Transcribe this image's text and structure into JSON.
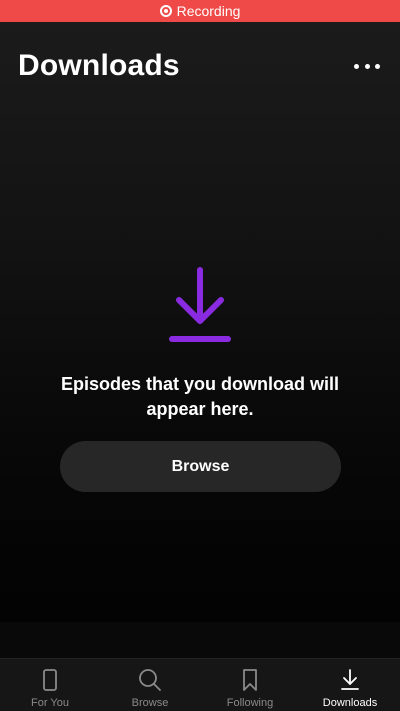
{
  "status_bar": {
    "recording_label": "Recording",
    "color": "#ef4a47"
  },
  "header": {
    "title": "Downloads",
    "more_icon": "more-horizontal-icon"
  },
  "empty_state": {
    "icon": "download-arrow-icon",
    "icon_color": "#8a2be2",
    "message": "Episodes that you download will appear here.",
    "browse_button": "Browse"
  },
  "tab_bar": {
    "tabs": [
      {
        "label": "For You",
        "icon": "phone-icon",
        "active": false
      },
      {
        "label": "Browse",
        "icon": "search-icon",
        "active": false
      },
      {
        "label": "Following",
        "icon": "bookmark-icon",
        "active": false
      },
      {
        "label": "Downloads",
        "icon": "download-icon",
        "active": true
      }
    ]
  }
}
